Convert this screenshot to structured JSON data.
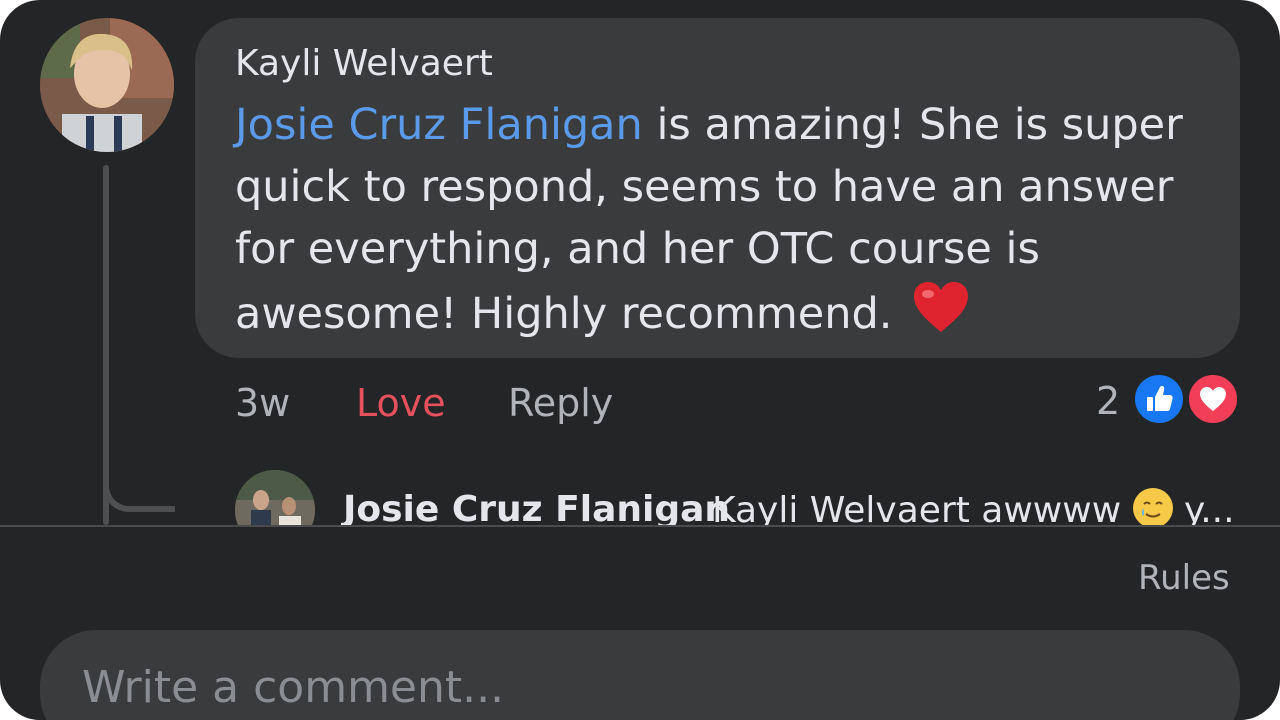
{
  "comment": {
    "author": "Kayli Welvaert",
    "mention": "Josie Cruz Flanigan",
    "body": " is amazing! She is super quick to respond, seems to have an answer for everything, and her OTC course is awesome! Highly recommend. ",
    "emoji": "red-heart-emoji"
  },
  "meta": {
    "time": "3w",
    "love_label": "Love",
    "reply_label": "Reply"
  },
  "reactions": {
    "count": "2",
    "types": [
      "like",
      "love"
    ],
    "colors": {
      "like": "#1877f2",
      "love": "#f33e58",
      "love_text": "#e4505c",
      "mention": "#5b9ae8"
    }
  },
  "reply_preview": {
    "author": "Josie Cruz Flanigan",
    "text": "Kayli Welvaert awwww ",
    "emoji": "smiling-face-with-tear-emoji",
    "trailing": " y..."
  },
  "footer": {
    "rules_label": "Rules",
    "composer_placeholder": "Write a comment..."
  }
}
